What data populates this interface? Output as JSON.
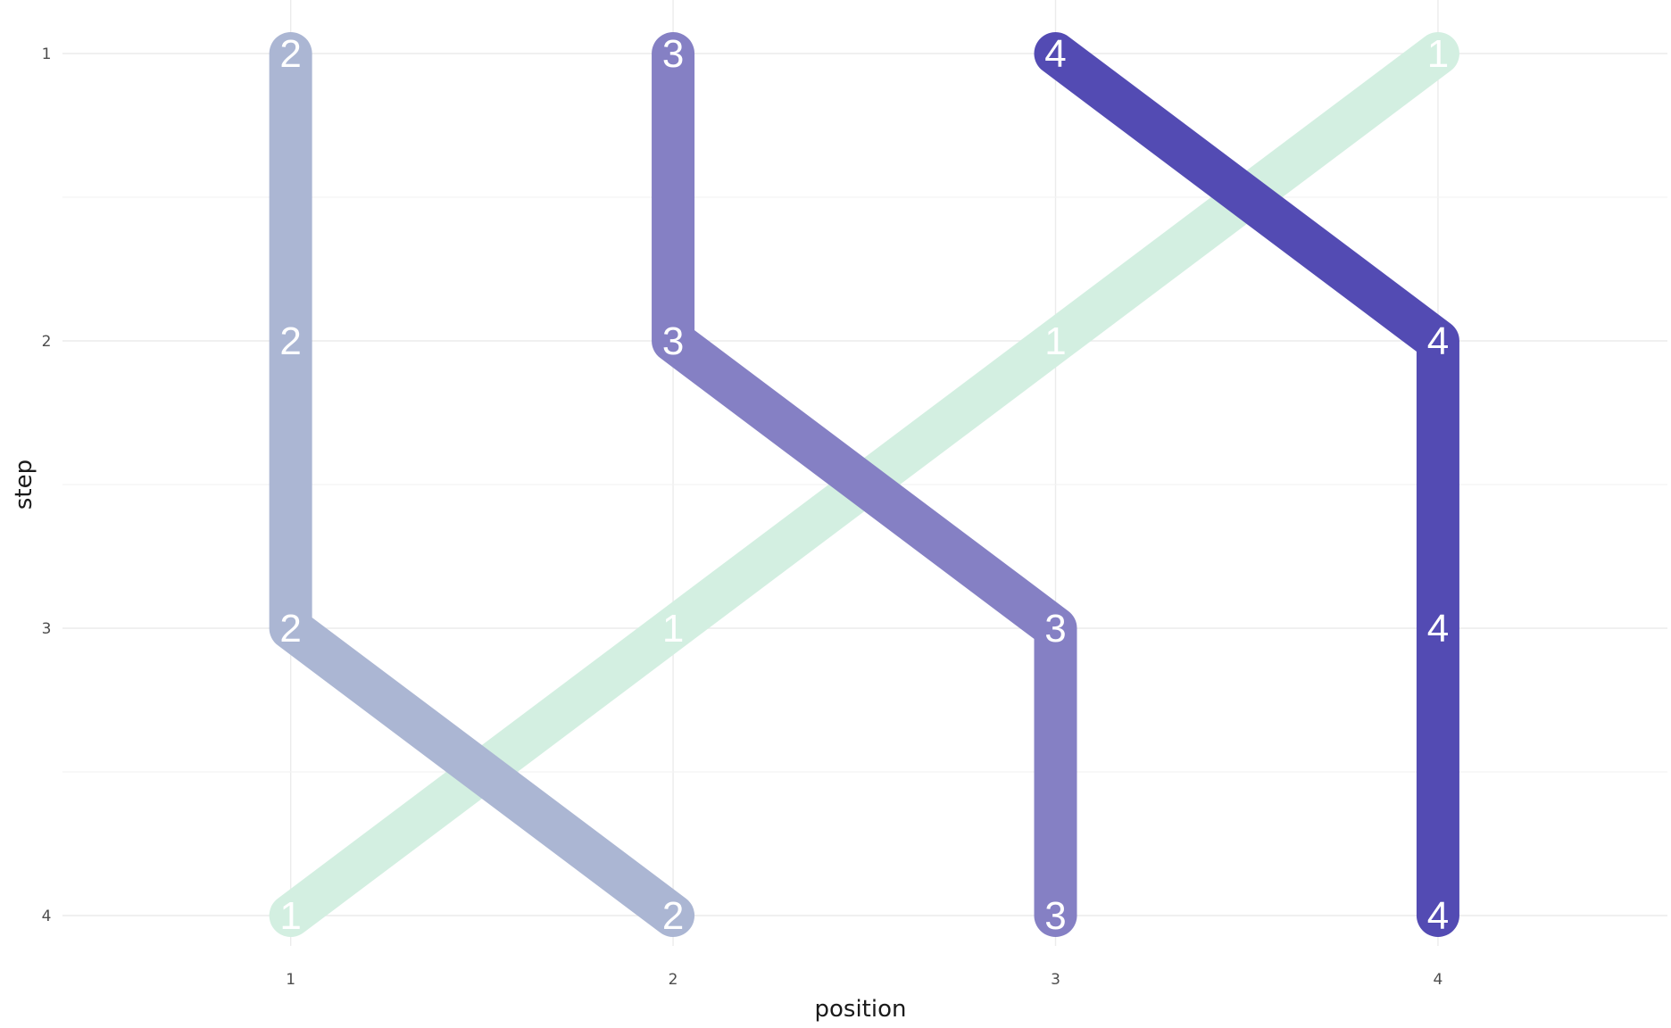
{
  "chart_data": {
    "type": "line",
    "xlabel": "position",
    "ylabel": "step",
    "x_ticks": [
      "1",
      "2",
      "3",
      "4"
    ],
    "y_ticks": [
      "1",
      "2",
      "3",
      "4"
    ],
    "xlim": [
      0.38,
      4.6
    ],
    "ylim": [
      1,
      4
    ],
    "y_reversed": true,
    "grid": true,
    "legend": "none",
    "series": [
      {
        "label": "1",
        "color": "#d3efe1",
        "points": [
          {
            "x": 4,
            "y": 1
          },
          {
            "x": 3,
            "y": 2
          },
          {
            "x": 2,
            "y": 3
          },
          {
            "x": 1,
            "y": 4
          }
        ]
      },
      {
        "label": "2",
        "color": "#abb6d3",
        "points": [
          {
            "x": 1,
            "y": 1
          },
          {
            "x": 1,
            "y": 2
          },
          {
            "x": 1,
            "y": 3
          },
          {
            "x": 2,
            "y": 4
          }
        ]
      },
      {
        "label": "3",
        "color": "#8580c4",
        "points": [
          {
            "x": 2,
            "y": 1
          },
          {
            "x": 2,
            "y": 2
          },
          {
            "x": 3,
            "y": 3
          },
          {
            "x": 3,
            "y": 4
          }
        ]
      },
      {
        "label": "4",
        "color": "#534bb3",
        "points": [
          {
            "x": 3,
            "y": 1
          },
          {
            "x": 4,
            "y": 2
          },
          {
            "x": 4,
            "y": 3
          },
          {
            "x": 4,
            "y": 4
          }
        ]
      }
    ]
  }
}
